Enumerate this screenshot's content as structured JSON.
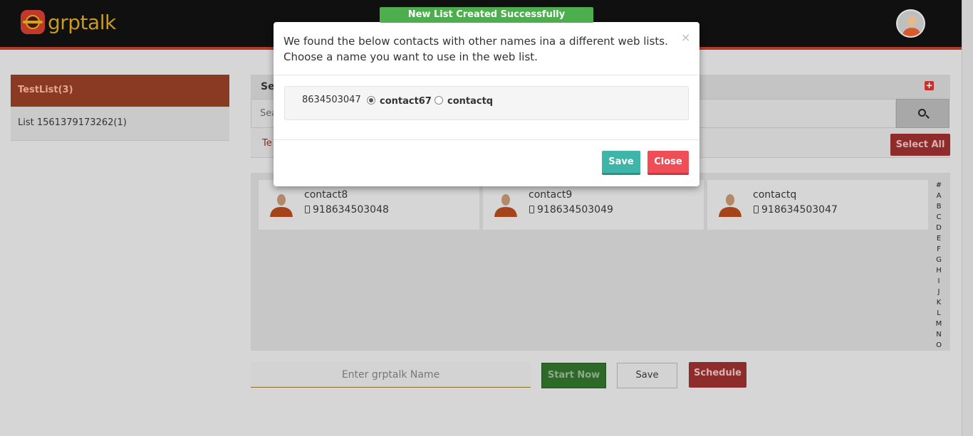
{
  "app": {
    "logo_text": "grptalk"
  },
  "toast": {
    "message": "New List Created Successfully"
  },
  "lists": [
    {
      "label": "TestList(3)"
    },
    {
      "label": "List 1561379173262(1)"
    }
  ],
  "panel": {
    "heading": "Se",
    "search_placeholder": "Sea",
    "tab_label": "Te",
    "select_all_label": "Select All"
  },
  "contacts": [
    {
      "name": "contact8",
      "phone": "918634503048"
    },
    {
      "name": "contact9",
      "phone": "918634503049"
    },
    {
      "name": "contactq",
      "phone": "918634503047"
    }
  ],
  "alphabet": [
    "#",
    "A",
    "B",
    "C",
    "D",
    "E",
    "F",
    "G",
    "H",
    "I",
    "J",
    "K",
    "L",
    "M",
    "N",
    "O"
  ],
  "footer": {
    "name_placeholder": "Enter grptalk Name",
    "start_now_label": "Start Now",
    "save_label": "Save",
    "schedule_label": "Schedule"
  },
  "modal": {
    "title_line1": "We found the below contacts with other names ina a different web lists.",
    "title_line2": "Choose a name you want to use in the web list.",
    "close_x": "×",
    "number": "8634503047",
    "options": [
      {
        "label": "contact67",
        "selected": true
      },
      {
        "label": "contactq",
        "selected": false
      }
    ],
    "save_label": "Save",
    "close_label": "Close"
  },
  "colors": {
    "toast_bg": "#4cae4c",
    "modal_save": "#3fb4a8",
    "modal_close": "#f04e57",
    "list_active": "#e8734a"
  }
}
